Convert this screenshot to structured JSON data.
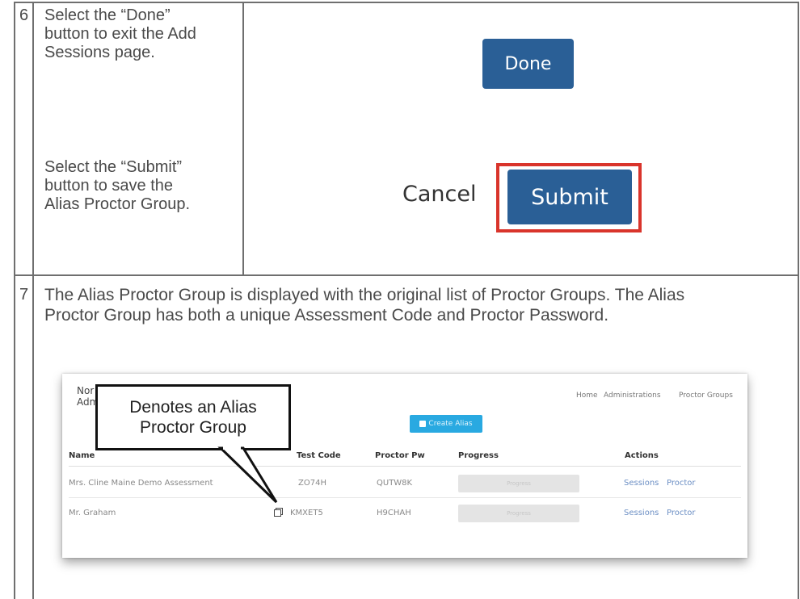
{
  "step6": {
    "number": "6",
    "instruction_done": [
      "Select the “Done”",
      "button to exit the Add",
      "Sessions page."
    ],
    "done_label": "Done",
    "instruction_submit": [
      "Select the “Submit”",
      "button to save the",
      "Alias Proctor Group."
    ],
    "cancel_label": "Cancel",
    "submit_label": "Submit",
    "highlight_color": "#d9342b",
    "button_color": "#2a5f96"
  },
  "step7": {
    "number": "7",
    "paragraph": [
      "The Alias Proctor Group is displayed with the original list of Proctor Groups. The Alias",
      "Proctor Group has both a unique Assessment Code and Proctor Password."
    ]
  },
  "screenshot": {
    "header_left": [
      "Nor",
      "Adm"
    ],
    "nav": [
      "Home",
      "Administrations",
      "Proctor Groups"
    ],
    "create_alias_label": "Create Alias",
    "create_alias_icon": "plus-square-icon",
    "columns": [
      "Name",
      "Test Code",
      "Proctor Pw",
      "Progress",
      "Actions"
    ],
    "rows": [
      {
        "name": "Mrs. Cline Maine Demo Assessment",
        "test_code": "ZO74H",
        "proctor_pw": "QUTW8K",
        "progress": "Progress",
        "actions": [
          "Sessions",
          "Proctor"
        ],
        "alias": false
      },
      {
        "name": "Mr. Graham",
        "test_code": "KMXET5",
        "proctor_pw": "H9CHAH",
        "progress": "Progress",
        "actions": [
          "Sessions",
          "Proctor"
        ],
        "alias": true,
        "alias_icon": "copy-icon"
      }
    ]
  },
  "callout": {
    "lines": [
      "Denotes an Alias",
      "Proctor Group"
    ]
  }
}
